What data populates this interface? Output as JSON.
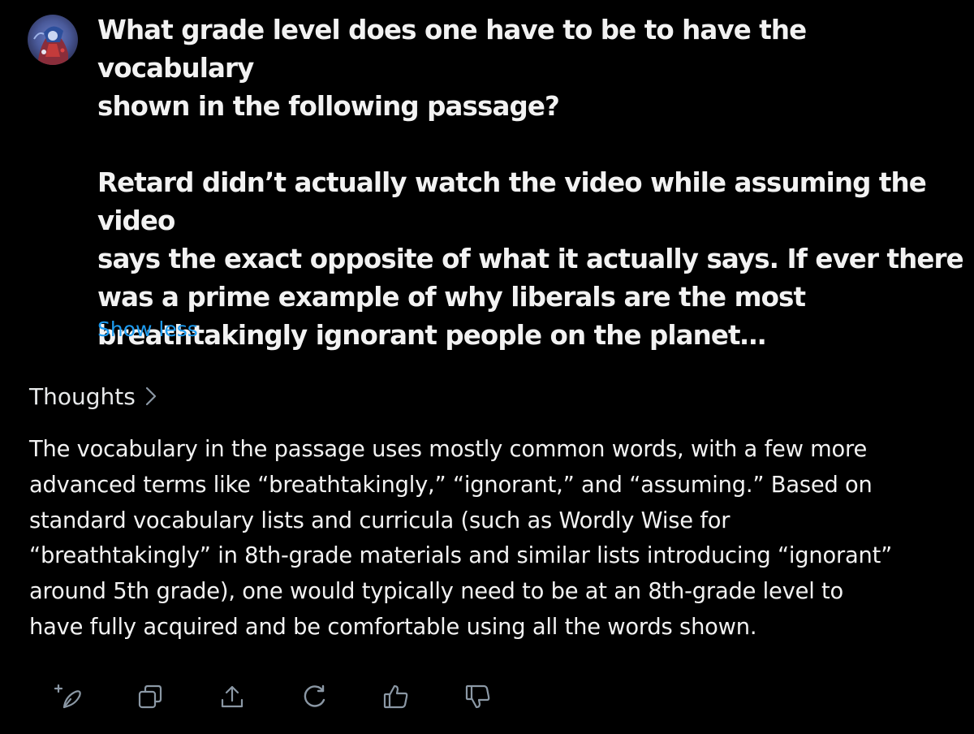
{
  "conversation": {
    "user_message": {
      "question": "What grade level does one have to be to have the vocabulary\nshown in the following passage?",
      "passage": "Retard didn’t actually watch the video while assuming the video\nsays the exact opposite of what it actually says. If ever there\nwas a prime example of why liberals are the most\nbreathtakingly ignorant people on the planet…",
      "show_less_label": "Show less"
    },
    "response": {
      "thoughts_label": "Thoughts",
      "text": "The vocabulary in the passage uses mostly common words, with a few more\nadvanced terms like “breathtakingly,” “ignorant,” and “assuming.” Based on\nstandard vocabulary lists and curricula (such as Wordly Wise for\n“breathtakingly” in 8th-grade materials and similar lists introducing “ignorant”\naround 5th grade), one would typically need to be at an 8th-grade level to\nhave fully acquired and be comfortable using all the words shown."
    }
  },
  "actions": [
    {
      "icon": "sparkle-pen-icon"
    },
    {
      "icon": "copy-icon"
    },
    {
      "icon": "share-icon"
    },
    {
      "icon": "regenerate-icon"
    },
    {
      "icon": "thumbs-up-icon"
    },
    {
      "icon": "thumbs-down-icon"
    }
  ],
  "colors": {
    "background": "#000000",
    "text": "#f2f2f2",
    "link": "#1d9bf0",
    "icon": "#8b98a5"
  }
}
